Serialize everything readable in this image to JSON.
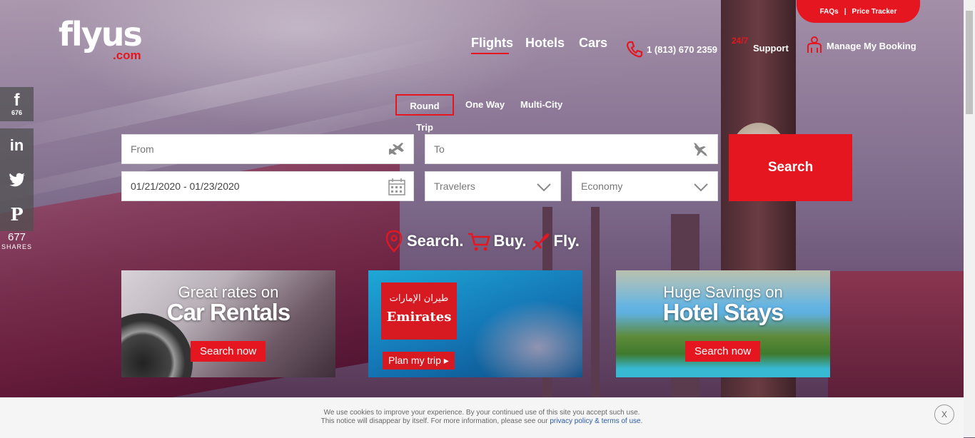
{
  "brand": {
    "name": "flyus",
    "suffix": ".com"
  },
  "top_pill": {
    "faqs": "FAQs",
    "separator": "|",
    "price_tracker": "Price Tracker"
  },
  "nav": {
    "flights": "Flights",
    "hotels": "Hotels",
    "cars": "Cars"
  },
  "utility": {
    "phone": "1 (813) 670 2359",
    "support_badge": "24/7",
    "support": "Support",
    "manage": "Manage My Booking"
  },
  "trip_types": {
    "round": "Round Trip",
    "one_way": "One Way",
    "multi": "Multi-City"
  },
  "form": {
    "from_placeholder": "From",
    "to_placeholder": "To",
    "dates": "01/21/2020 - 01/23/2020",
    "travelers": "Travelers",
    "cabin": "Economy",
    "search": "Search"
  },
  "tagline": {
    "search": "Search.",
    "buy": "Buy.",
    "fly": "Fly."
  },
  "social": {
    "facebook_count": "676",
    "total": "677",
    "shares_label": "SHARES"
  },
  "banners": {
    "car": {
      "line1": "Great rates on",
      "line2": "Car Rentals",
      "cta": "Search now"
    },
    "emirates": {
      "logo_arabic": "طيران الإمارات",
      "logo": "Emirates",
      "cta": "Plan my trip ▸"
    },
    "hotel": {
      "line1": "Huge Savings on",
      "line2": "Hotel Stays",
      "cta": "Search now"
    }
  },
  "cookie": {
    "line1": "We use cookies to improve your experience. By your continued use of this site you accept such use.",
    "line2_prefix": "This notice will disappear by itself. For more information, please see our",
    "privacy": "privacy policy",
    "amp": "&",
    "terms": "terms of use",
    "period": ".",
    "close": "X"
  },
  "colors": {
    "accent": "#e5161f",
    "emirates_red": "#d71921"
  }
}
